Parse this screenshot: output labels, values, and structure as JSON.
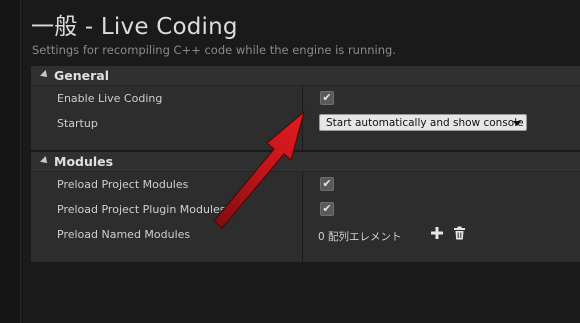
{
  "page": {
    "title": "一般 - Live Coding",
    "subtitle": "Settings for recompiling C++ code while the engine is running."
  },
  "sections": {
    "general": {
      "title": "General",
      "rows": {
        "enable_live_coding": {
          "label": "Enable Live Coding",
          "checked": true
        },
        "startup": {
          "label": "Startup",
          "value": "Start automatically and show console"
        }
      }
    },
    "modules": {
      "title": "Modules",
      "rows": {
        "preload_project_modules": {
          "label": "Preload Project Modules",
          "checked": true
        },
        "preload_project_plugin_modules": {
          "label": "Preload Project Plugin Modules",
          "checked": true
        },
        "preload_named_modules": {
          "label": "Preload Named Modules",
          "value": "0 配列エレメント"
        }
      }
    }
  },
  "icons": {
    "checkmark": "✔",
    "add": "plus-icon",
    "delete": "trash-icon",
    "annotation_arrow_color": "#d0161b"
  }
}
